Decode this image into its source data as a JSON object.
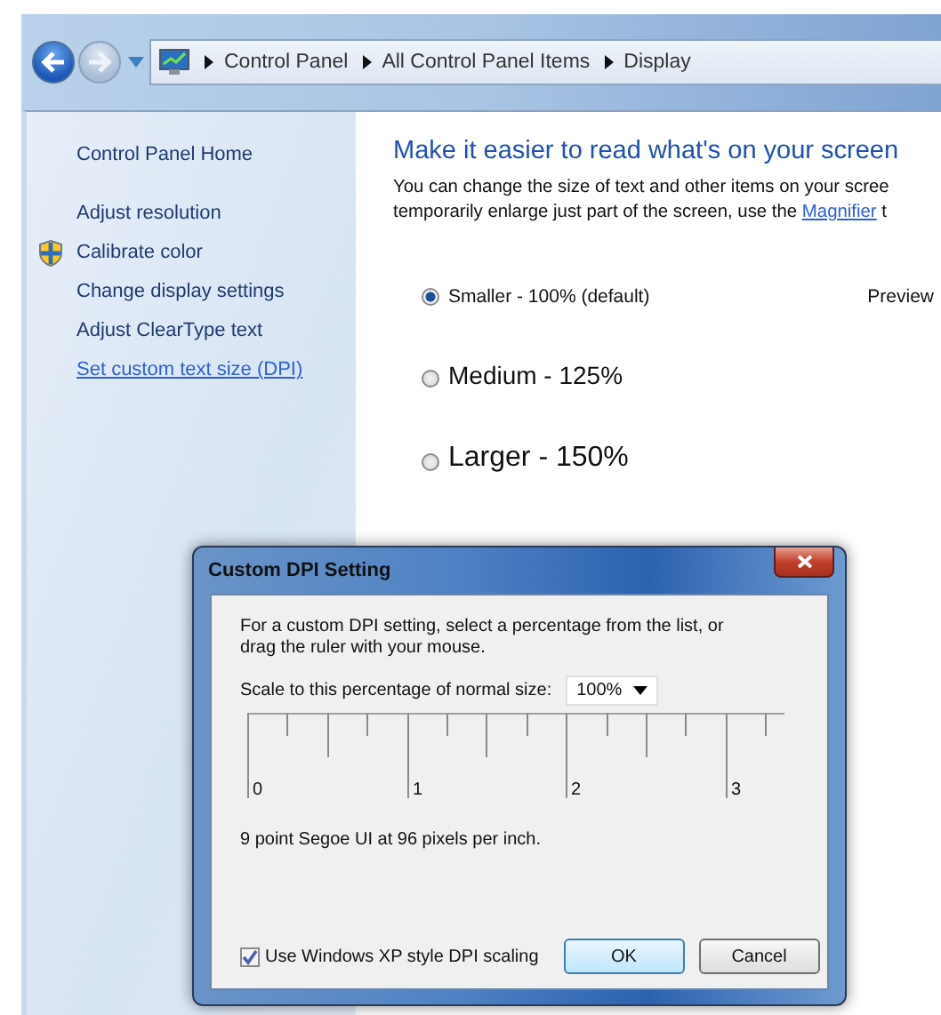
{
  "breadcrumb": [
    "Control Panel",
    "All Control Panel Items",
    "Display"
  ],
  "sidebar": {
    "items": [
      {
        "label": "Control Panel Home",
        "kind": "home"
      },
      {
        "label": "Adjust resolution",
        "kind": "plain"
      },
      {
        "label": "Calibrate color",
        "kind": "shield"
      },
      {
        "label": "Change display settings",
        "kind": "plain"
      },
      {
        "label": "Adjust ClearType text",
        "kind": "plain"
      },
      {
        "label": "Set custom text size (DPI)",
        "kind": "link"
      }
    ]
  },
  "main": {
    "title": "Make it easier to read what's on your screen",
    "description": [
      [
        {
          "kind": "text",
          "text": "You can change the size of text and other items on your scree"
        }
      ],
      [
        {
          "kind": "text",
          "text": "temporarily enlarge just part of the screen, use the"
        },
        {
          "kind": "link",
          "text": "Magnifier"
        },
        {
          "kind": "text",
          "text": "t"
        }
      ]
    ],
    "options": [
      {
        "label": "Smaller - 100% (default)",
        "kind": "small",
        "selected": true
      },
      {
        "label": "Medium - 125%",
        "kind": "medium",
        "selected": false
      },
      {
        "label": "Larger - 150%",
        "kind": "large",
        "selected": false
      }
    ],
    "preview_label": "Preview"
  },
  "dialog": {
    "title": "Custom DPI Setting",
    "instructions": "For a custom DPI setting, select a percentage from the list, or drag the ruler with your mouse.",
    "scale_label": "Scale to this percentage of normal size:",
    "scale_value": "100%",
    "ruler_labels": [
      "0",
      "1",
      "2",
      "3"
    ],
    "info": "9 point Segoe UI at 96 pixels per inch.",
    "xp_scaling": {
      "label": "Use Windows XP style DPI scaling",
      "checked": true
    },
    "buttons": [
      {
        "label": "OK",
        "kind": "default"
      },
      {
        "label": "Cancel",
        "kind": "normal"
      }
    ]
  }
}
